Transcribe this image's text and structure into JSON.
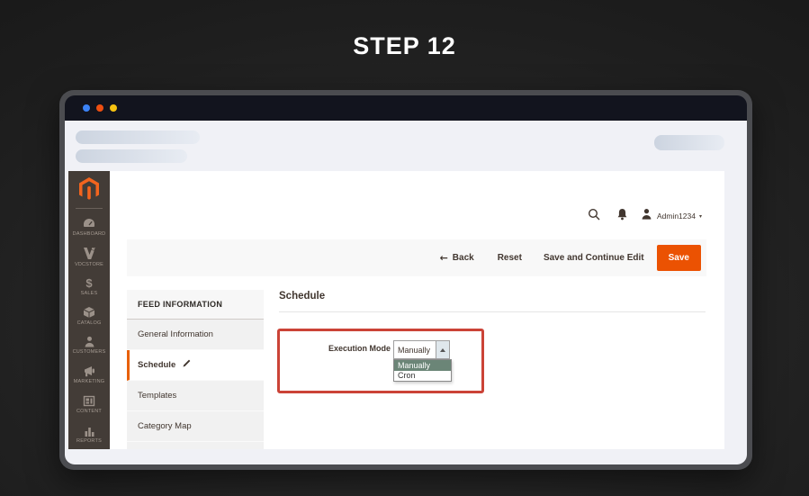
{
  "title": "STEP 12",
  "browser": {
    "dot_colors": [
      "#3b82f6",
      "#ee4f11",
      "#f5c211"
    ]
  },
  "admin": {
    "header": {
      "username": "Admin1234",
      "caret": "▾"
    },
    "sidebar": {
      "items": [
        {
          "label": "DASHBOARD",
          "icon": "dashboard-icon"
        },
        {
          "label": "VDCSTORE",
          "icon": "vdcstore-icon"
        },
        {
          "label": "SALES",
          "icon": "sales-icon"
        },
        {
          "label": "CATALOG",
          "icon": "catalog-icon"
        },
        {
          "label": "CUSTOMERS",
          "icon": "customers-icon"
        },
        {
          "label": "MARKETING",
          "icon": "marketing-icon"
        },
        {
          "label": "CONTENT",
          "icon": "content-icon"
        },
        {
          "label": "REPORTS",
          "icon": "reports-icon"
        }
      ]
    },
    "toolbar": {
      "back_arrow": "←",
      "back": "Back",
      "reset": "Reset",
      "save_continue": "Save and Continue Edit",
      "save": "Save"
    },
    "nav": {
      "title": "FEED INFORMATION",
      "items": [
        {
          "label": "General Information",
          "active": false
        },
        {
          "label": "Schedule",
          "active": true
        },
        {
          "label": "Templates",
          "active": false
        },
        {
          "label": "Category Map",
          "active": false
        }
      ]
    },
    "content": {
      "heading": "Schedule",
      "field_label": "Execution Mode",
      "select_value": "Manually",
      "dropdown_options": [
        {
          "label": "Manually",
          "selected": true
        },
        {
          "label": "Cron",
          "selected": false
        }
      ]
    }
  },
  "colors": {
    "accent_orange": "#eb5202",
    "magento_logo_orange": "#f3641e",
    "highlight_red": "#cb4337",
    "option_selected_green": "#6b8577",
    "sidebar_bg": "#433c37",
    "titlebar_bg": "#12141e"
  }
}
